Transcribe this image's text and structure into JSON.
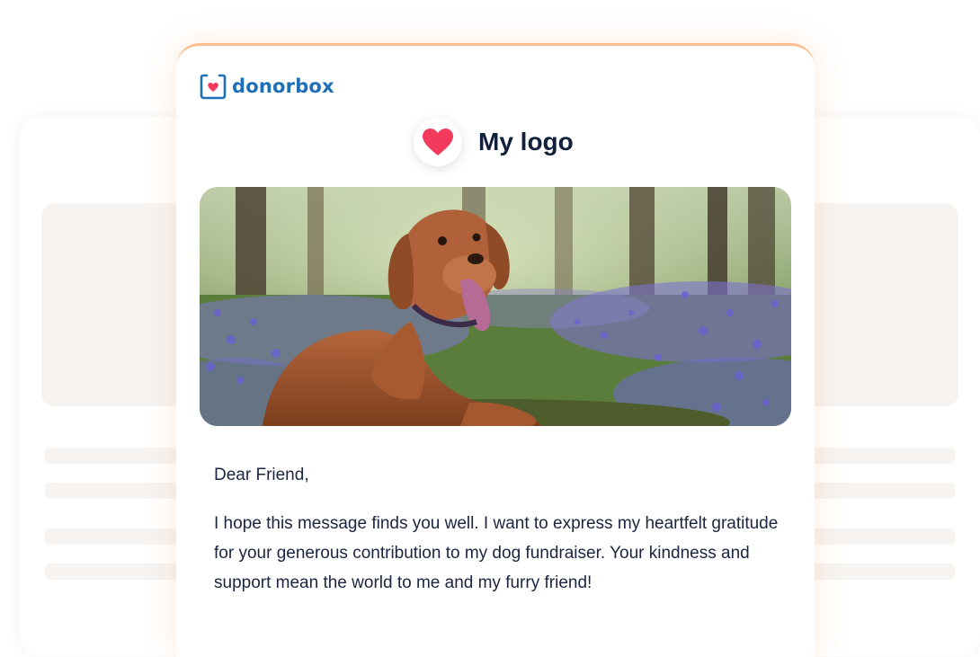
{
  "brand": {
    "name": "donorbox",
    "icon": "donorbox-heart-box-icon",
    "color": "#1d6fb8"
  },
  "header": {
    "logo_icon": "heart-icon",
    "logo_label": "My logo",
    "accent": "#f23b5c"
  },
  "hero_image": {
    "subject": "dog-in-bluebell-field-image"
  },
  "letter": {
    "greeting": "Dear Friend,",
    "body": "I hope this message finds you well. I want to express my heartfelt gratitude for your generous contribution to my dog fundraiser. Your kindness and support mean the world to me and my furry friend!"
  },
  "colors": {
    "card_border": "#fdbd8d",
    "background_blocks": "#f6f3f1",
    "text": "#1b2540"
  }
}
